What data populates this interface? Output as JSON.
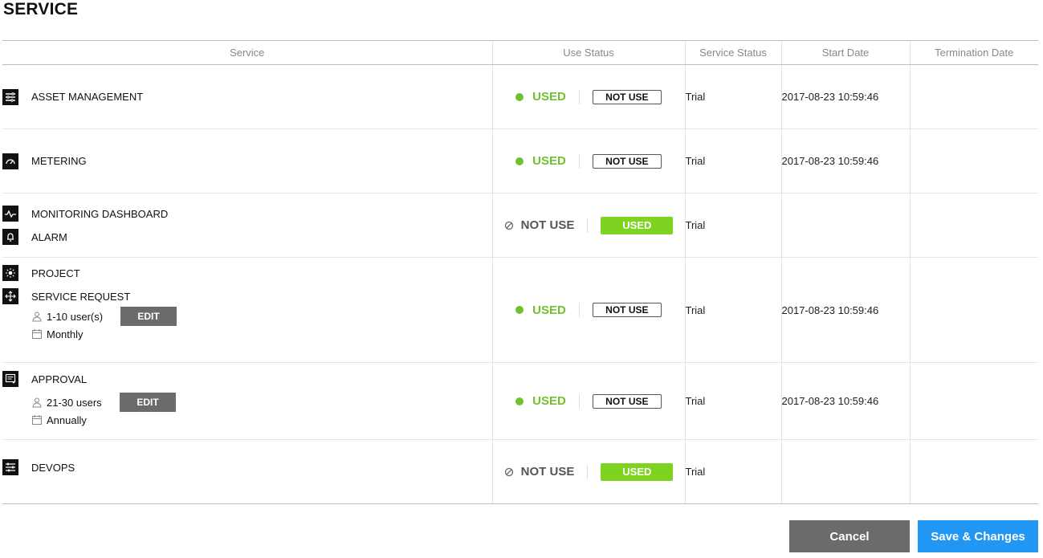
{
  "page_title": "SERVICE",
  "columns": [
    "Service",
    "Use Status",
    "Service Status",
    "Start Date",
    "Termination Date"
  ],
  "labels": {
    "used": "USED",
    "not_use": "NOT USE",
    "edit": "EDIT"
  },
  "colors": {
    "accent_green": "#71c12e",
    "used_button": "#7ed321",
    "primary_blue": "#2196f3",
    "gray_button": "#6b6b6b"
  },
  "rows": [
    {
      "services": [
        {
          "name": "ASSET MANAGEMENT",
          "icon": "list-icon"
        }
      ],
      "use_status": "USED",
      "service_status": "Trial",
      "start_date": "2017-08-23 10:59:46",
      "termination_date": ""
    },
    {
      "services": [
        {
          "name": "METERING",
          "icon": "gauge-icon"
        }
      ],
      "use_status": "USED",
      "service_status": "Trial",
      "start_date": "2017-08-23 10:59:46",
      "termination_date": ""
    },
    {
      "services": [
        {
          "name": "MONITORING DASHBOARD",
          "icon": "pulse-icon"
        },
        {
          "name": "ALARM",
          "icon": "bell-icon"
        }
      ],
      "use_status": "NOT USE",
      "service_status": "Trial",
      "start_date": "",
      "termination_date": ""
    },
    {
      "services": [
        {
          "name": "PROJECT",
          "icon": "sun-icon"
        },
        {
          "name": "SERVICE REQUEST",
          "icon": "arrows-icon"
        }
      ],
      "users": "1-10 user(s)",
      "billing": "Monthly",
      "use_status": "USED",
      "service_status": "Trial",
      "start_date": "2017-08-23 10:59:46",
      "termination_date": ""
    },
    {
      "services": [
        {
          "name": "APPROVAL",
          "icon": "approval-icon"
        }
      ],
      "users": "21-30 users",
      "billing": "Annually",
      "use_status": "USED",
      "service_status": "Trial",
      "start_date": "2017-08-23 10:59:46",
      "termination_date": ""
    },
    {
      "services": [
        {
          "name": "DEVOPS",
          "icon": "sliders-icon"
        }
      ],
      "use_status": "NOT USE",
      "service_status": "Trial",
      "start_date": "",
      "termination_date": ""
    }
  ],
  "footer": {
    "cancel": "Cancel",
    "save": "Save & Changes"
  }
}
